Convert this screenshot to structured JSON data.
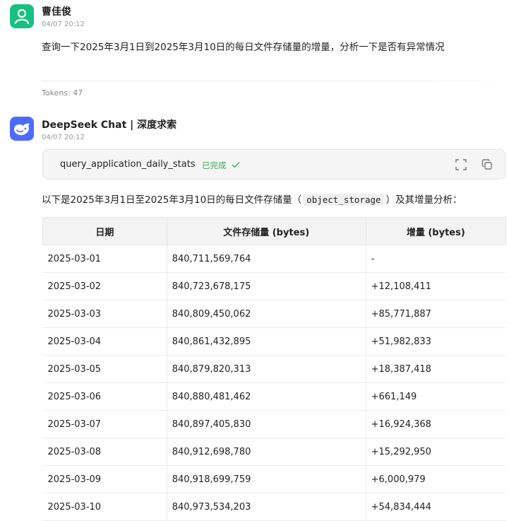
{
  "user": {
    "name": "曹佳俊",
    "time": "04/07 20:12",
    "question": "查询一下2025年3月1日到2025年3月10日的每日文件存储量的增量，分析一下是否有异常情况",
    "tokens": "Tokens: 47"
  },
  "bot": {
    "name": "DeepSeek Chat | 深度求索",
    "time": "04/07 20:12",
    "tool": {
      "name": "query_application_daily_stats",
      "status": "已完成",
      "expand_icon": "expand-icon",
      "copy_icon": "copy-icon"
    },
    "intro_before": "以下是2025年3月1日至2025年3月10日的每日文件存储量（",
    "intro_code": "object_storage",
    "intro_after": "）及其增量分析："
  },
  "table": {
    "headers": [
      "日期",
      "文件存储量 (bytes)",
      "增量 (bytes)"
    ],
    "rows": [
      [
        "2025-03-01",
        "840,711,569,764",
        "-"
      ],
      [
        "2025-03-02",
        "840,723,678,175",
        "+12,108,411"
      ],
      [
        "2025-03-03",
        "840,809,450,062",
        "+85,771,887"
      ],
      [
        "2025-03-04",
        "840,861,432,895",
        "+51,982,833"
      ],
      [
        "2025-03-05",
        "840,879,820,313",
        "+18,387,418"
      ],
      [
        "2025-03-06",
        "840,880,481,462",
        "+661,149"
      ],
      [
        "2025-03-07",
        "840,897,405,830",
        "+16,924,368"
      ],
      [
        "2025-03-08",
        "840,912,698,780",
        "+15,292,950"
      ],
      [
        "2025-03-09",
        "840,918,699,759",
        "+6,000,979"
      ],
      [
        "2025-03-10",
        "840,973,534,203",
        "+54,834,444"
      ]
    ]
  },
  "colors": {
    "user_avatar": "#18c081",
    "bot_avatar": "#4d6bfe",
    "status_green": "#3ca85b"
  }
}
